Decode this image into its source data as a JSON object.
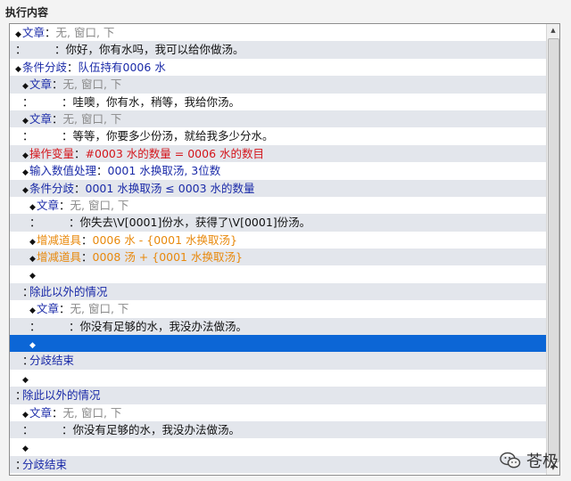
{
  "group_title": "执行内容",
  "sep": "：",
  "rows": [
    {
      "indent": 1,
      "kind": "cmd",
      "label": "文章",
      "value": "无, 窗口, 下",
      "label_color": "#1a2aa8",
      "value_color": "#8a8a8a"
    },
    {
      "indent": 1,
      "kind": "cont",
      "value": "你好，你有水吗，我可以给你做汤。",
      "value_color": "#111111"
    },
    {
      "indent": 1,
      "kind": "cmd",
      "label": "条件分歧",
      "value": "队伍持有0006 水",
      "label_color": "#1a2aa8",
      "value_color": "#1a2aa8"
    },
    {
      "indent": 2,
      "kind": "cmd",
      "label": "文章",
      "value": "无, 窗口, 下",
      "label_color": "#1a2aa8",
      "value_color": "#8a8a8a"
    },
    {
      "indent": 2,
      "kind": "cont",
      "value": "哇噢，你有水，稍等，我给你汤。",
      "value_color": "#111111"
    },
    {
      "indent": 2,
      "kind": "cmd",
      "label": "文章",
      "value": "无, 窗口, 下",
      "label_color": "#1a2aa8",
      "value_color": "#8a8a8a"
    },
    {
      "indent": 2,
      "kind": "cont",
      "value": "等等，你要多少份汤，就给我多少分水。",
      "value_color": "#111111"
    },
    {
      "indent": 2,
      "kind": "cmd",
      "label": "操作变量",
      "value": "#0003 水的数量 = 0006 水的数目",
      "label_color": "#d4151b",
      "value_color": "#d4151b"
    },
    {
      "indent": 2,
      "kind": "cmd",
      "label": "输入数值处理",
      "value": "0001 水换取汤, 3位数",
      "label_color": "#1a2aa8",
      "value_color": "#1a2aa8"
    },
    {
      "indent": 2,
      "kind": "cmd",
      "label": "条件分歧",
      "value": "0001 水换取汤 ≤ 0003 水的数量",
      "label_color": "#1a2aa8",
      "value_color": "#1a2aa8"
    },
    {
      "indent": 3,
      "kind": "cmd",
      "label": "文章",
      "value": "无, 窗口, 下",
      "label_color": "#1a2aa8",
      "value_color": "#8a8a8a"
    },
    {
      "indent": 3,
      "kind": "cont",
      "value": "你失去\\V[0001]份水，获得了\\V[0001]份汤。",
      "value_color": "#111111"
    },
    {
      "indent": 3,
      "kind": "cmd",
      "label": "增减道具",
      "value": "0006 水 - {0001 水换取汤}",
      "label_color": "#e8890c",
      "value_color": "#e8890c"
    },
    {
      "indent": 3,
      "kind": "cmd",
      "label": "增减道具",
      "value": "0008 汤 + {0001 水换取汤}",
      "label_color": "#e8890c",
      "value_color": "#e8890c"
    },
    {
      "indent": 3,
      "kind": "empty"
    },
    {
      "indent": 2,
      "kind": "branch",
      "value": "除此以外的情况",
      "value_color": "#1a2aa8"
    },
    {
      "indent": 3,
      "kind": "cmd",
      "label": "文章",
      "value": "无, 窗口, 下",
      "label_color": "#1a2aa8",
      "value_color": "#8a8a8a"
    },
    {
      "indent": 3,
      "kind": "cont",
      "value": "你没有足够的水，我没办法做汤。",
      "value_color": "#111111"
    },
    {
      "indent": 3,
      "kind": "empty",
      "selected": true
    },
    {
      "indent": 2,
      "kind": "branch",
      "value": "分歧结束",
      "value_color": "#1a2aa8"
    },
    {
      "indent": 2,
      "kind": "empty"
    },
    {
      "indent": 1,
      "kind": "branch",
      "value": "除此以外的情况",
      "value_color": "#1a2aa8"
    },
    {
      "indent": 2,
      "kind": "cmd",
      "label": "文章",
      "value": "无, 窗口, 下",
      "label_color": "#1a2aa8",
      "value_color": "#8a8a8a"
    },
    {
      "indent": 2,
      "kind": "cont",
      "value": "你没有足够的水，我没办法做汤。",
      "value_color": "#111111"
    },
    {
      "indent": 2,
      "kind": "empty"
    },
    {
      "indent": 1,
      "kind": "branch",
      "value": "分歧结束",
      "value_color": "#1a2aa8"
    }
  ],
  "watermark": {
    "text": "苍极",
    "icon": "wechat-icon"
  },
  "colors": {
    "selected_row": "#0c66d6",
    "alt_row": "#e3e6ec"
  }
}
